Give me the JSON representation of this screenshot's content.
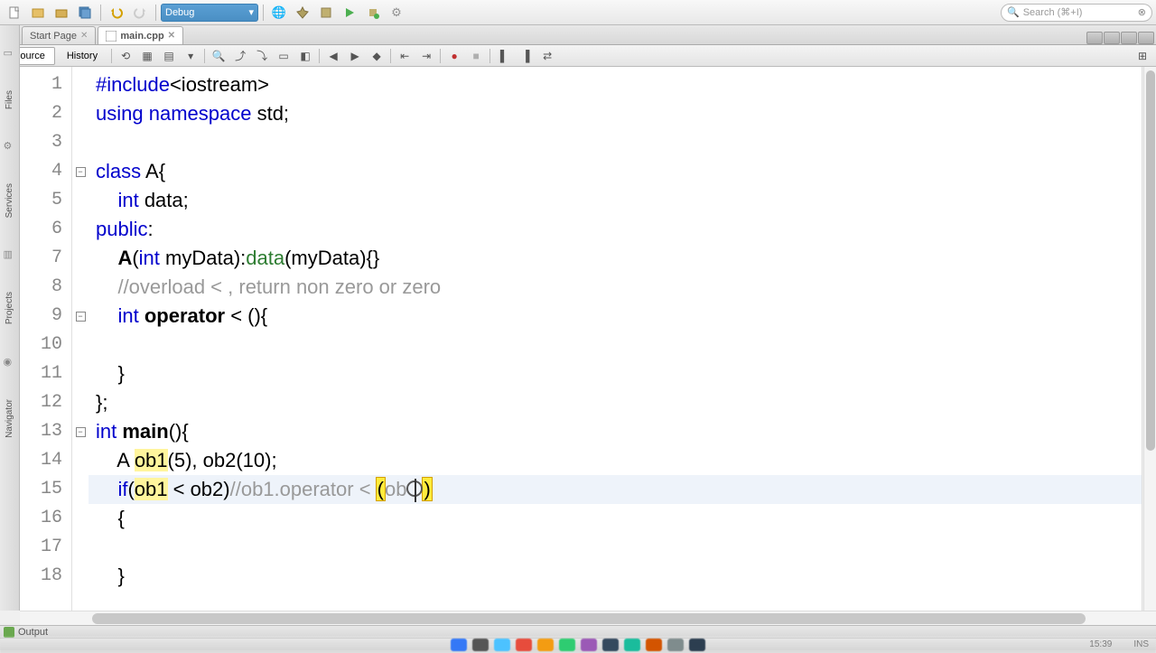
{
  "toolbar": {
    "config_label": "Debug",
    "search_placeholder": "Search (⌘+I)"
  },
  "tabs": {
    "start": "Start Page",
    "active": "main.cpp"
  },
  "editor_tabs": {
    "source": "Source",
    "history": "History"
  },
  "left_rail": {
    "files": "Files",
    "services": "Services",
    "projects": "Projects",
    "navigator": "Navigator"
  },
  "code": {
    "lines": [
      {
        "n": 1,
        "fold": "",
        "html": "<span class='kw'>#include</span>&lt;iostream&gt;"
      },
      {
        "n": 2,
        "fold": "",
        "html": "<span class='kw'>using</span> <span class='kw'>namespace</span> std;"
      },
      {
        "n": 3,
        "fold": "",
        "html": ""
      },
      {
        "n": 4,
        "fold": "-",
        "html": "<span class='kw'>class</span> A{"
      },
      {
        "n": 5,
        "fold": "",
        "html": "    <span class='kw'>int</span> data;"
      },
      {
        "n": 6,
        "fold": "",
        "html": "<span class='kw'>public</span>:"
      },
      {
        "n": 7,
        "fold": "",
        "html": "    <span class='ident-bold'>A</span>(<span class='kw'>int</span> myData):<span style='color:#2e7d32'>data</span>(myData){}"
      },
      {
        "n": 8,
        "fold": "",
        "html": "    <span class='comment'>//overload &lt; , return non zero or zero</span>"
      },
      {
        "n": 9,
        "fold": "-",
        "html": "    <span class='kw'>int</span> <span class='ident-bold'>operator</span> &lt; (){"
      },
      {
        "n": 10,
        "fold": "",
        "html": ""
      },
      {
        "n": 11,
        "fold": "",
        "html": "    }"
      },
      {
        "n": 12,
        "fold": "",
        "html": "};"
      },
      {
        "n": 13,
        "fold": "-",
        "html": "<span class='kw'>int</span> <span class='ident-bold'>main</span>(){"
      },
      {
        "n": 14,
        "fold": "",
        "html": "    A <span class='hl-word'>ob1</span>(5), ob2(10);"
      },
      {
        "n": 15,
        "fold": "",
        "html": "    <span class='kw'>if</span>(<span class='hl-word'>ob1</span> &lt; ob2)<span class='comment'>//ob1.operator &lt; </span><span class='hl-paren'>(</span><span class='comment'>ob</span><span class='cursor-ring'></span><span class='hl-paren'>)</span>",
        "current": true
      },
      {
        "n": 16,
        "fold": "",
        "html": "    {"
      },
      {
        "n": 17,
        "fold": "",
        "html": ""
      },
      {
        "n": 18,
        "fold": "",
        "html": "    }"
      }
    ]
  },
  "footer": {
    "output": "Output"
  },
  "status": {
    "pos": "15:39",
    "ins": "INS"
  }
}
